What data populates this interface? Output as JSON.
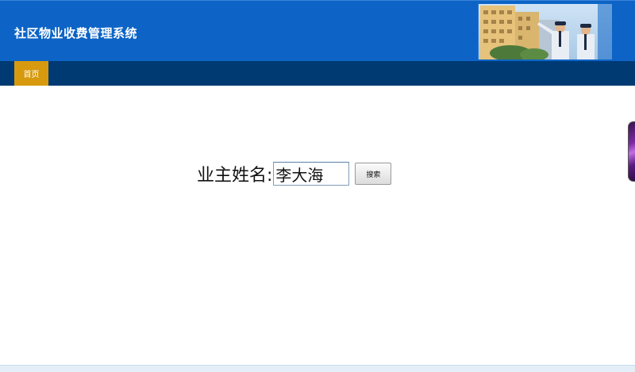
{
  "header": {
    "title": "社区物业收费管理系统"
  },
  "nav": {
    "items": [
      {
        "label": "首页",
        "active": true
      }
    ]
  },
  "search": {
    "label": "业主姓名:",
    "value": "李大海",
    "button_label": "搜索"
  },
  "colors": {
    "header_bg": "#0d64c6",
    "nav_bg": "#003a73",
    "nav_active": "#d79a0e"
  }
}
